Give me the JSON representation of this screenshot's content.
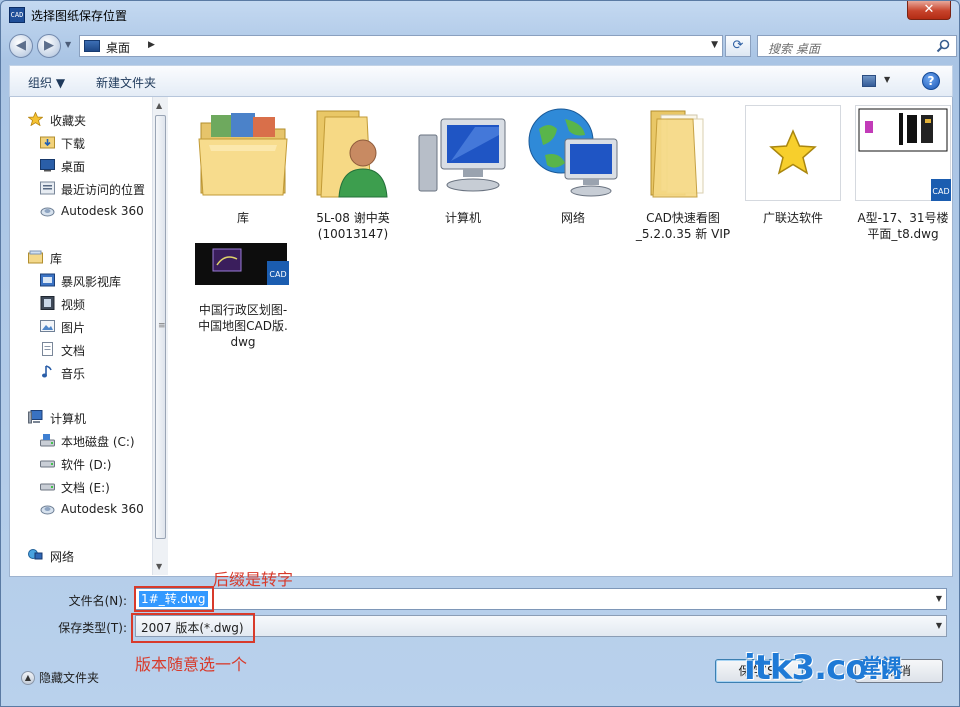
{
  "window": {
    "title": "选择图纸保存位置",
    "app_icon_text": "CAD",
    "close_glyph": "✕"
  },
  "nav": {
    "back_glyph": "◀",
    "forward_glyph": "▶",
    "dropdown_glyph": "▼",
    "refresh_glyph": "⟳"
  },
  "address": {
    "location": "桌面",
    "separator": "▶"
  },
  "search": {
    "placeholder": "搜索 桌面"
  },
  "toolbar": {
    "organize_label": "组织 ▼",
    "new_folder_label": "新建文件夹",
    "help_glyph": "?"
  },
  "sidebar": {
    "favorites": {
      "label": "收藏夹",
      "items": [
        "下载",
        "桌面",
        "最近访问的位置",
        "Autodesk 360"
      ]
    },
    "libraries": {
      "label": "库",
      "items": [
        "暴风影视库",
        "视频",
        "图片",
        "文档",
        "音乐"
      ]
    },
    "computer": {
      "label": "计算机",
      "items": [
        "本地磁盘 (C:)",
        "软件 (D:)",
        "文档 (E:)",
        "Autodesk 360"
      ]
    },
    "network": {
      "label": "网络"
    }
  },
  "files": [
    {
      "line1": "库",
      "line2": "",
      "line3": ""
    },
    {
      "line1": "5L-08  谢中英",
      "line2": "(10013147)",
      "line3": ""
    },
    {
      "line1": "计算机",
      "line2": "",
      "line3": ""
    },
    {
      "line1": "网络",
      "line2": "",
      "line3": ""
    },
    {
      "line1": "CAD快速看图",
      "line2": "_5.2.0.35 新 VIP",
      "line3": ""
    },
    {
      "line1": "广联达软件",
      "line2": "",
      "line3": ""
    },
    {
      "line1": "A型-17、31号楼",
      "line2": "平面_t8.dwg",
      "line3": ""
    },
    {
      "line1": "中国行政区划图-",
      "line2": "中国地图CAD版.",
      "line3": "dwg"
    }
  ],
  "cad_badge": "CAD",
  "form": {
    "filename_label": "文件名(N):",
    "filename_value": "1#_转.dwg",
    "filetype_label": "保存类型(T):",
    "filetype_value": "2007 版本(*.dwg)",
    "hide_folders_label": "隐藏文件夹",
    "save_label": "保存(S)",
    "cancel_label": "取消"
  },
  "annotations": {
    "suffix_note": "后缀是转字",
    "version_note": "版本随意选一个"
  },
  "watermark": {
    "main": "itk3.com",
    "side": "堂课"
  },
  "colors": {
    "annotation_red": "#d83a2b",
    "selection_blue": "#3399ff",
    "watermark_blue": "#1f7ad6"
  }
}
